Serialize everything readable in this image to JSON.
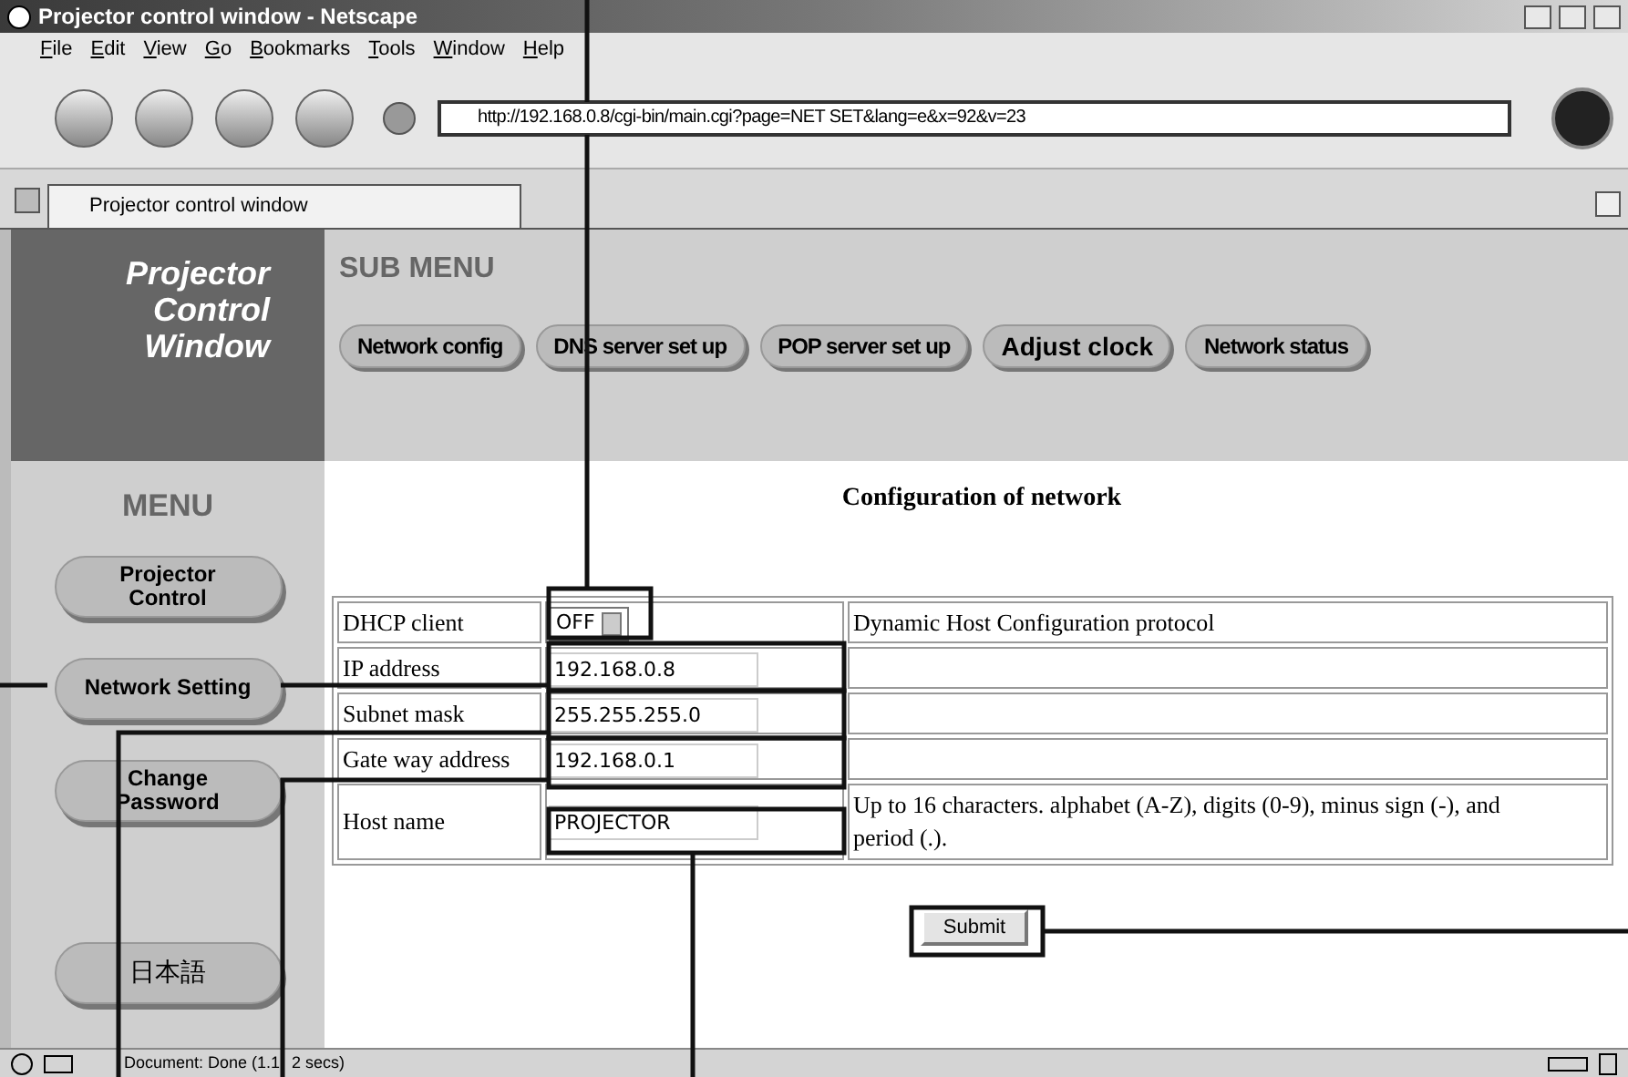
{
  "window": {
    "title": "Projector control window - Netscape"
  },
  "menu_bar": [
    "File",
    "Edit",
    "View",
    "Go",
    "Bookmarks",
    "Tools",
    "Window",
    "Help"
  ],
  "address_bar": {
    "value": "http://192.168.0.8/cgi-bin/main.cgi?page=NET SET&lang=e&x=92&v=23"
  },
  "tabs": [
    {
      "label": "Projector control window",
      "selected": true
    }
  ],
  "page": {
    "logo": [
      "Projector",
      "Control",
      "Window"
    ],
    "sub_menu_title": "SUB MENU",
    "sub_menu": [
      "Network config",
      "DNS server set up",
      "POP server set up",
      "Adjust clock",
      "Network status"
    ],
    "menu_title": "MENU",
    "menu": [
      [
        "Projector",
        "Control"
      ],
      [
        "Network Setting"
      ],
      [
        "Change",
        "Password"
      ],
      [
        "日本語"
      ]
    ],
    "heading": "Configuration of network",
    "form_rows": [
      {
        "label": "DHCP client",
        "kind": "select",
        "value": "OFF",
        "note": "Dynamic Host Configuration protocol"
      },
      {
        "label": "IP address",
        "kind": "text",
        "value": "192.168.0.8"
      },
      {
        "label": "Subnet mask",
        "kind": "text",
        "value": "255.255.255.0"
      },
      {
        "label": "Gate way address",
        "kind": "text",
        "value": "192.168.0.1"
      },
      {
        "label": "Host name",
        "kind": "text",
        "value": "PROJECTOR",
        "note": "Up to 16 characters. alphabet (A-Z), digits (0-9), minus sign (-), and period (.)."
      }
    ],
    "submit": "Submit"
  },
  "status_bar": {
    "texts": [
      "Document: Done (1.1",
      "2 secs)"
    ]
  }
}
